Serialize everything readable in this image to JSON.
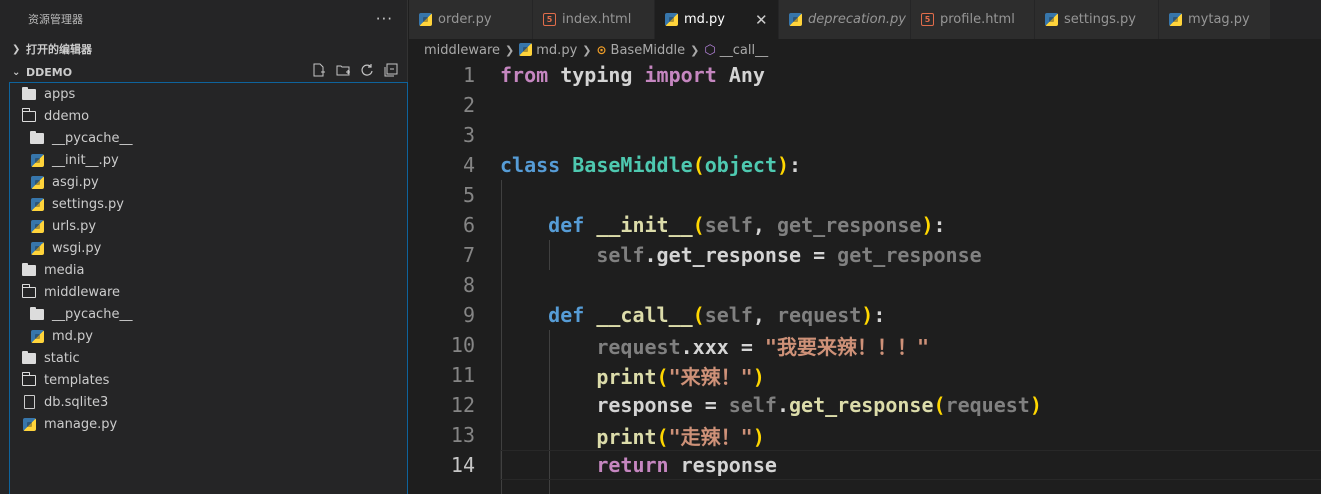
{
  "explorer": {
    "title": "资源管理器",
    "more": "···",
    "open_editors": "打开的编辑器",
    "project": "DDEMO",
    "actions": [
      "new-file-icon",
      "new-folder-icon",
      "refresh-icon",
      "collapse-icon"
    ],
    "tree": [
      {
        "label": "apps",
        "type": "folder-closed",
        "level": 0
      },
      {
        "label": "ddemo",
        "type": "folder-open",
        "level": 0
      },
      {
        "label": "__pycache__",
        "type": "folder-closed",
        "level": 1
      },
      {
        "label": "__init__.py",
        "type": "py",
        "level": 1
      },
      {
        "label": "asgi.py",
        "type": "py",
        "level": 1
      },
      {
        "label": "settings.py",
        "type": "py",
        "level": 1
      },
      {
        "label": "urls.py",
        "type": "py",
        "level": 1
      },
      {
        "label": "wsgi.py",
        "type": "py",
        "level": 1
      },
      {
        "label": "media",
        "type": "folder-closed",
        "level": 0
      },
      {
        "label": "middleware",
        "type": "folder-open",
        "level": 0
      },
      {
        "label": "__pycache__",
        "type": "folder-closed",
        "level": 1
      },
      {
        "label": "md.py",
        "type": "py",
        "level": 1
      },
      {
        "label": "static",
        "type": "folder-closed",
        "level": 0
      },
      {
        "label": "templates",
        "type": "folder-open",
        "level": 0
      },
      {
        "label": "db.sqlite3",
        "type": "file",
        "level": 0
      },
      {
        "label": "manage.py",
        "type": "py",
        "level": 0
      }
    ]
  },
  "tabs": [
    {
      "label": "order.py",
      "icon": "py",
      "active": false,
      "italic": false
    },
    {
      "label": "index.html",
      "icon": "html",
      "active": false,
      "italic": false
    },
    {
      "label": "md.py",
      "icon": "py",
      "active": true,
      "italic": false
    },
    {
      "label": "deprecation.py",
      "icon": "py",
      "active": false,
      "italic": true
    },
    {
      "label": "profile.html",
      "icon": "html",
      "active": false,
      "italic": false
    },
    {
      "label": "settings.py",
      "icon": "py",
      "active": false,
      "italic": false
    },
    {
      "label": "mytag.py",
      "icon": "py",
      "active": false,
      "italic": false
    }
  ],
  "tab_close": "✕",
  "breadcrumb": {
    "folder": "middleware",
    "file": "md.py",
    "class": "BaseMiddle",
    "method": "__call__"
  },
  "code": {
    "line_numbers": [
      "1",
      "2",
      "3",
      "4",
      "5",
      "6",
      "7",
      "8",
      "9",
      "10",
      "11",
      "12",
      "13",
      "14"
    ],
    "current_line": "14",
    "t": {
      "from": "from",
      "typing": "typing",
      "import": "import",
      "Any": "Any",
      "class": "class",
      "BaseMiddle": "BaseMiddle",
      "object": "object",
      "def": "def",
      "init": "__init__",
      "self": "self",
      "get_response": "get_response",
      "call": "__call__",
      "request": "request",
      "xxx": "xxx",
      "str1": "\"我要来辣！！！\"",
      "print": "print",
      "str2": "\"来辣！\"",
      "response": "response",
      "str3": "\"走辣！\"",
      "return": "return"
    }
  }
}
